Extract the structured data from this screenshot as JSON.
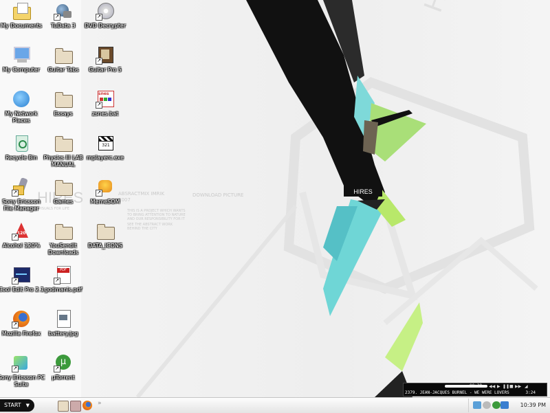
{
  "desktop": {
    "icons": [
      {
        "label": "My Documents",
        "icon": "my-documents-icon"
      },
      {
        "label": "My Computer",
        "icon": "my-computer-icon"
      },
      {
        "label": "My Network Places",
        "icon": "network-places-icon"
      },
      {
        "label": "Recycle Bin",
        "icon": "recycle-bin-icon"
      },
      {
        "label": "Sony Ericsson File Manager",
        "icon": "phone-icon"
      },
      {
        "label": "Alcohol 120%",
        "icon": "alcohol-icon"
      },
      {
        "label": "Cool Edit Pro 2.1",
        "icon": "cool-edit-icon"
      },
      {
        "label": "Mozilla Firefox",
        "icon": "firefox-icon"
      },
      {
        "label": "Sony Ericsson PC Suite",
        "icon": "pc-suite-icon"
      },
      {
        "label": "TuData 3",
        "icon": "tudata-icon"
      },
      {
        "label": "Guitar Tabs",
        "icon": "folder-icon"
      },
      {
        "label": "Essays",
        "icon": "folder-icon"
      },
      {
        "label": "Physics III LAB MANUAL",
        "icon": "folder-icon"
      },
      {
        "label": "Games",
        "icon": "folder-icon"
      },
      {
        "label": "YouSendIt Downloads",
        "icon": "folder-icon"
      },
      {
        "label": "godmanis.pdf",
        "icon": "pdf-icon"
      },
      {
        "label": "battery.jpg",
        "icon": "image-file-icon"
      },
      {
        "label": "µTorrent",
        "icon": "utorrent-icon"
      },
      {
        "label": "DVD Decrypter",
        "icon": "dvd-icon"
      },
      {
        "label": "Guitar Pro 5",
        "icon": "guitar-pro-icon"
      },
      {
        "label": "zsnes.bat",
        "icon": "snes-icon"
      },
      {
        "label": "mplayerc.exe",
        "icon": "clapper-icon"
      },
      {
        "label": "MemeSOM",
        "icon": "meme-icon"
      },
      {
        "label": "DATA_ICONS",
        "icon": "folder-icon"
      }
    ]
  },
  "wallpaper": {
    "brand": "HIRES",
    "brand_small": "HIRES",
    "hires_sub": "VISUALS FOR LIFE",
    "wm_title": "ABSRACTMIX IMRIK",
    "wm_year": "2007",
    "wm_lines": [
      "THIS IS A PROJECT WHICH WANTS",
      "TO BRING ATTENTION TO NATURE",
      "AND OUR RESPONSIBILITY FOR IT",
      "SEE THE ABSTRACT WORK",
      "BEHIND THE CITY"
    ],
    "wm_right": "DOWNLOAD PICTURE"
  },
  "taskbar": {
    "start_label": "START",
    "start_arrow": "▼",
    "quicklaunch_more": "»",
    "clock": "10:39 PM"
  },
  "player": {
    "time": "00:29",
    "track": "2379. JEAN-JACQUES BURNEL - WE WERE LOVERS",
    "length": "3:24"
  },
  "colors": {
    "accent": "#6fd6d6",
    "lime": "#b8e86a",
    "taskbar": "#f0f0f0"
  }
}
